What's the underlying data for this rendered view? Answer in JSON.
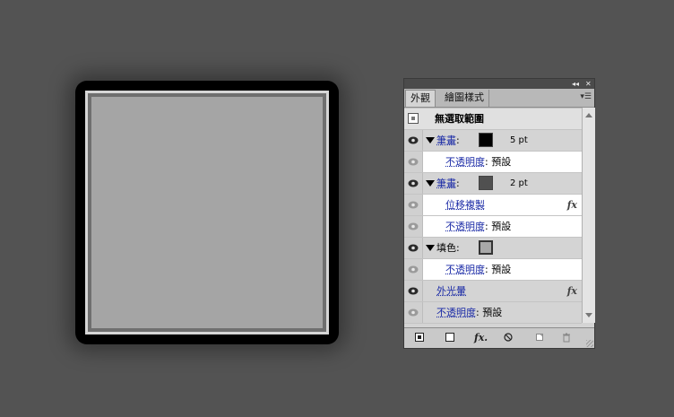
{
  "panel": {
    "tabs": [
      {
        "label": "外觀",
        "active": true
      },
      {
        "label": "繪圖樣式",
        "active": false
      }
    ],
    "header_label": "無選取範圍",
    "rows": [
      {
        "type": "stroke",
        "label": "筆畫",
        "colon": ":",
        "swatch_color": "#000000",
        "weight": "5 pt",
        "bg": "gray",
        "visible": true
      },
      {
        "type": "opacity",
        "label": "不透明度",
        "colon": ":",
        "value": "預設",
        "bg": "white",
        "visible": false
      },
      {
        "type": "stroke",
        "label": "筆畫",
        "colon": ":",
        "swatch_color": "#505050",
        "weight": "2 pt",
        "bg": "gray",
        "visible": true
      },
      {
        "type": "effect",
        "label": "位移複製",
        "bg": "white",
        "visible": false
      },
      {
        "type": "opacity",
        "label": "不透明度",
        "colon": ":",
        "value": "預設",
        "bg": "white",
        "visible": false
      },
      {
        "type": "fill",
        "label": "填色",
        "colon": ":",
        "swatch_color": "#a8a8a8",
        "bg": "gray",
        "visible": true
      },
      {
        "type": "opacity",
        "label": "不透明度",
        "colon": ":",
        "value": "預設",
        "bg": "white",
        "visible": false
      },
      {
        "type": "effect",
        "label": "外光暈",
        "bg": "gray",
        "visible": true
      },
      {
        "type": "opacity",
        "label": "不透明度",
        "colon": ":",
        "value": "預設",
        "bg": "gray",
        "visible": false
      }
    ],
    "fx_label": "fx",
    "bottom_fx_label": "fx."
  },
  "colors": {
    "canvas": "#535353",
    "artwork_outer": "#000000",
    "artwork_fill": "#a5a5a5",
    "link": "#1a2aa6"
  }
}
